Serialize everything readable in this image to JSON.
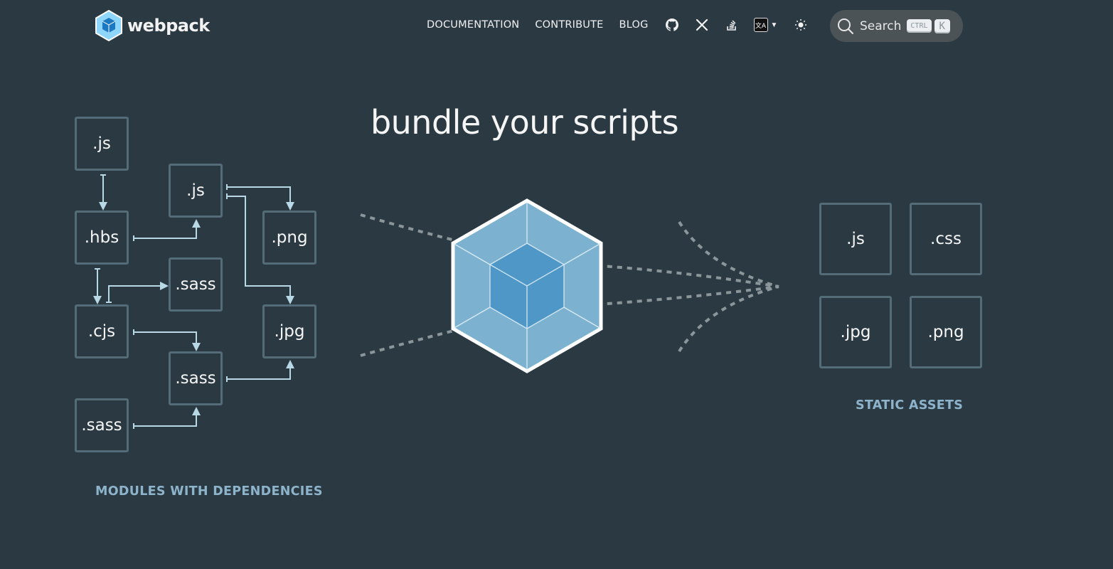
{
  "header": {
    "logo_text": "webpack",
    "nav": [
      "DOCUMENTATION",
      "CONTRIBUTE",
      "BLOG"
    ],
    "icons": [
      "github-icon",
      "x-icon",
      "stackoverflow-icon",
      "translate-icon",
      "theme-toggle-icon"
    ],
    "search": {
      "label": "Search",
      "shortcut_mod": "CTRL",
      "shortcut_key": "K"
    }
  },
  "hero": {
    "headline": "bundle your scripts",
    "modules_caption": "MODULES WITH DEPENDENCIES",
    "assets_caption": "STATIC ASSETS",
    "modules": [
      ".js",
      ".js",
      ".hbs",
      ".png",
      ".sass",
      ".cjs",
      ".jpg",
      ".sass",
      ".sass"
    ],
    "assets": [
      ".js",
      ".css",
      ".jpg",
      ".png"
    ]
  },
  "colors": {
    "background": "#2b3a42",
    "box_border": "#546c78",
    "caption": "#8eb4cc",
    "cube_outer": "#8ed6fb",
    "cube_inner": "#1c78c0"
  }
}
